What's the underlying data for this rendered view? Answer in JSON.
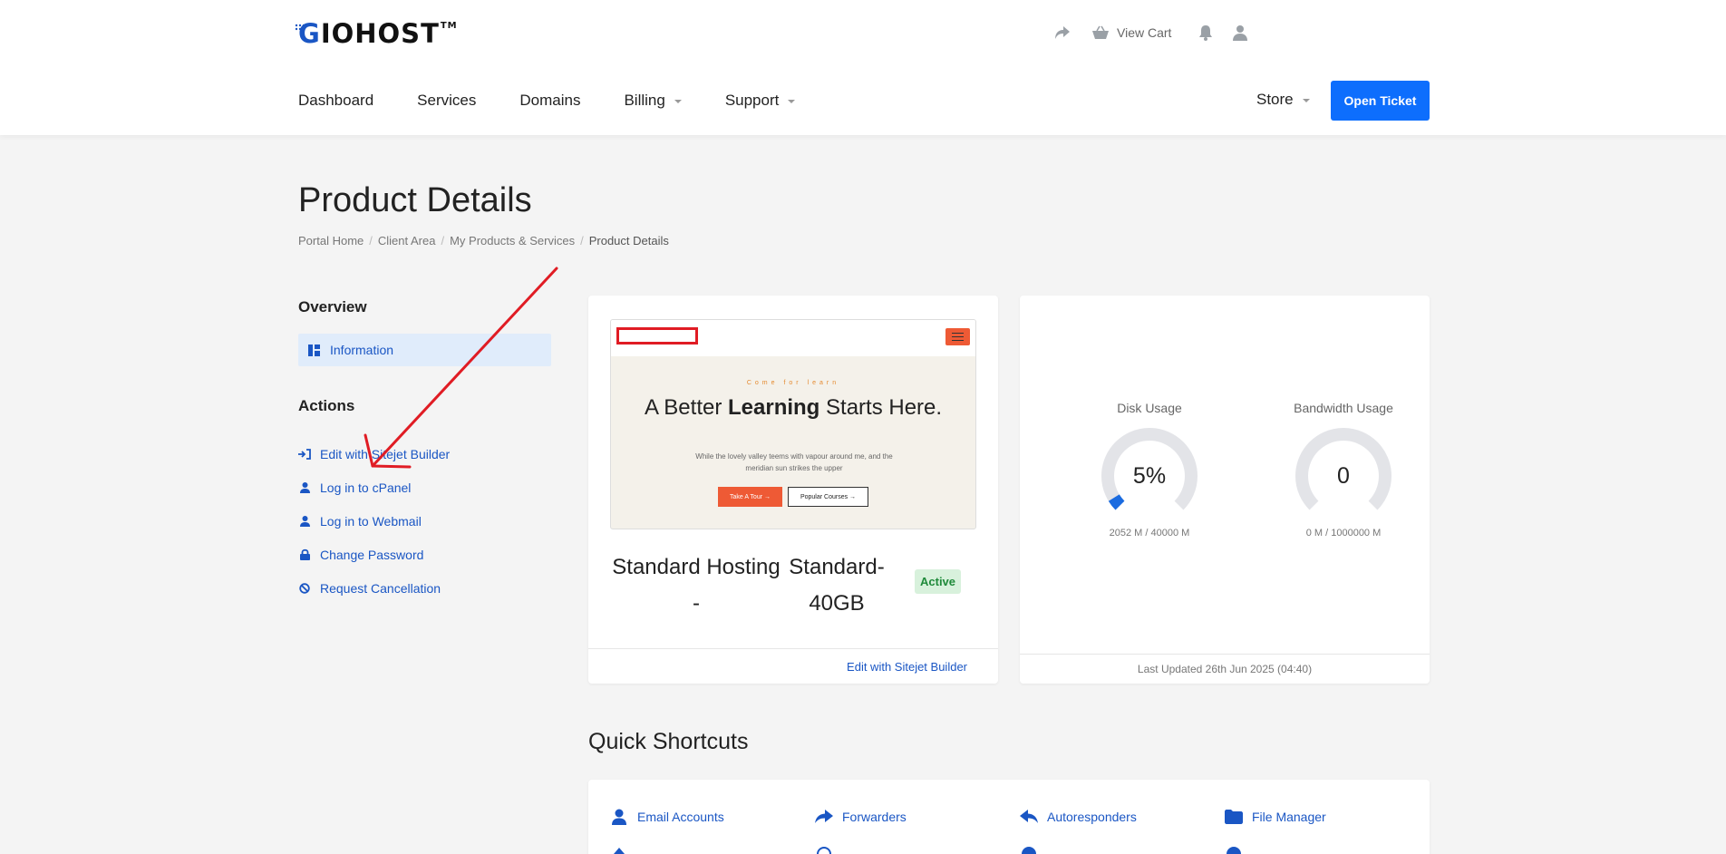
{
  "brand": {
    "logo_text": "IOHOST",
    "logo_g": "G",
    "logo_tm": "TM"
  },
  "header": {
    "view_cart": "View Cart",
    "nav": [
      "Dashboard",
      "Services",
      "Domains",
      "Billing",
      "Support"
    ],
    "store": "Store",
    "open_ticket": "Open Ticket"
  },
  "page": {
    "title": "Product Details",
    "breadcrumb": [
      "Portal Home",
      "Client Area",
      "My Products & Services",
      "Product Details"
    ]
  },
  "sidebar": {
    "overview_heading": "Overview",
    "information": "Information",
    "actions_heading": "Actions",
    "actions": [
      "Edit with Sitejet Builder",
      "Log in to cPanel",
      "Log in to Webmail",
      "Change Password",
      "Request Cancellation"
    ]
  },
  "product": {
    "preview": {
      "kicker": "Come for learn",
      "heading_a": "A Better ",
      "heading_b": "Learning",
      "heading_c": " Starts Here.",
      "para": "While the lovely valley teems with vapour around me, and the meridian sun strikes the upper",
      "btn1": "Take A Tour →",
      "btn2": "Popular Courses →"
    },
    "name_part1": "Standard Hosting -",
    "name_part2": "Standard-40GB",
    "status": "Active",
    "footer_link": "Edit with Sitejet Builder"
  },
  "usage": {
    "disk": {
      "label": "Disk Usage",
      "value": "5%",
      "percent": 5,
      "stats": "2052 M / 40000 M"
    },
    "bandwidth": {
      "label": "Bandwidth Usage",
      "value": "0",
      "percent": 0,
      "stats": "0 M / 1000000 M"
    },
    "last_updated": "Last Updated 26th Jun 2025 (04:40)"
  },
  "shortcuts": {
    "title": "Quick Shortcuts",
    "items": [
      "Email Accounts",
      "Forwarders",
      "Autoresponders",
      "File Manager"
    ]
  },
  "colors": {
    "accent": "#0d6efd",
    "link": "#1a56c4",
    "active_bg": "#d8f1dc",
    "annotation": "#e01c24"
  },
  "icons": {
    "top": [
      "share-icon",
      "cart-icon",
      "bell-icon",
      "user-icon"
    ],
    "actions": [
      "sign-in-icon",
      "user-icon",
      "user-icon",
      "lock-icon",
      "ban-icon"
    ],
    "shortcuts": [
      "user-icon",
      "forward-icon",
      "reply-icon",
      "folder-icon"
    ]
  }
}
